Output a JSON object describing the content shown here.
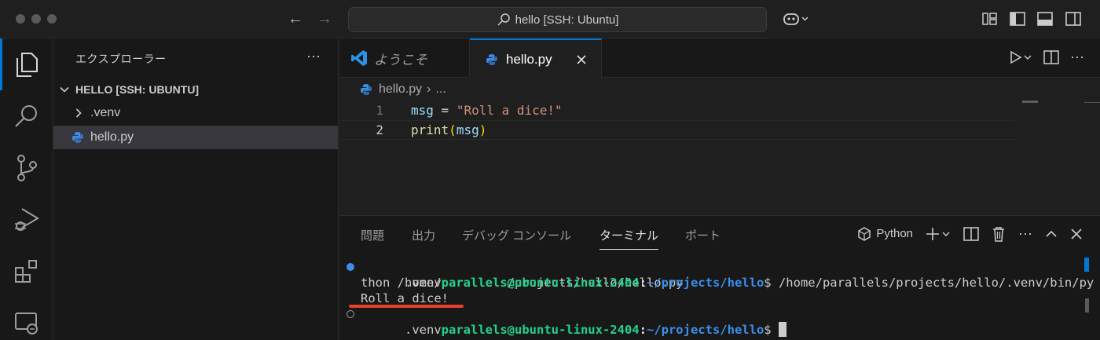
{
  "window": {
    "command_center": "hello [SSH: Ubuntu]"
  },
  "sidebar": {
    "title": "エクスプローラー",
    "root": "HELLO [SSH: UBUNTU]",
    "items": [
      {
        "label": ".venv",
        "type": "folder"
      },
      {
        "label": "hello.py",
        "type": "file"
      }
    ]
  },
  "editor": {
    "tabs": [
      {
        "label": "ようこそ",
        "active": false
      },
      {
        "label": "hello.py",
        "active": true
      }
    ],
    "breadcrumb": {
      "file": "hello.py",
      "rest": "..."
    },
    "lines": [
      {
        "num": "1",
        "tokens": [
          "msg",
          " = ",
          "\"Roll a dice!\""
        ]
      },
      {
        "num": "2",
        "tokens": [
          "print",
          "(",
          "msg",
          ")"
        ]
      }
    ]
  },
  "panel": {
    "tabs": [
      "問題",
      "出力",
      "デバッグ コンソール",
      "ターミナル",
      "ポート"
    ],
    "active_tab": "ターミナル",
    "terminal_name": "Python",
    "terminal": {
      "line1_prefix": ".venv",
      "user_host": "parallels@ubuntu-linux-2404",
      "colon": ":",
      "path": "~/projects/hello",
      "prompt": "$",
      "command_part1": " /home/parallels/projects/hello/.venv/bin/py",
      "command_part2": "thon /home/parallels/projects/hello/hello.py",
      "output": "Roll a dice!",
      "line4_prefix": ".venv"
    }
  },
  "colors": {
    "accent": "#0078d4",
    "highlight_underline": "#e8402a"
  }
}
